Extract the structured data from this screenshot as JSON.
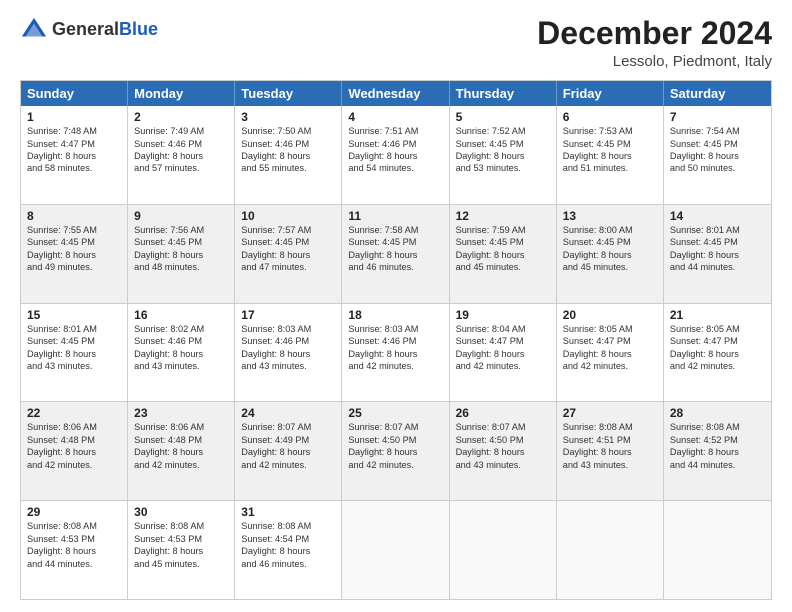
{
  "header": {
    "logo_general": "General",
    "logo_blue": "Blue",
    "month_title": "December 2024",
    "location": "Lessolo, Piedmont, Italy"
  },
  "days_of_week": [
    "Sunday",
    "Monday",
    "Tuesday",
    "Wednesday",
    "Thursday",
    "Friday",
    "Saturday"
  ],
  "rows": [
    [
      {
        "day": "",
        "text": "",
        "empty": true
      },
      {
        "day": "2",
        "text": "Sunrise: 7:49 AM\nSunset: 4:46 PM\nDaylight: 8 hours\nand 57 minutes."
      },
      {
        "day": "3",
        "text": "Sunrise: 7:50 AM\nSunset: 4:46 PM\nDaylight: 8 hours\nand 55 minutes."
      },
      {
        "day": "4",
        "text": "Sunrise: 7:51 AM\nSunset: 4:46 PM\nDaylight: 8 hours\nand 54 minutes."
      },
      {
        "day": "5",
        "text": "Sunrise: 7:52 AM\nSunset: 4:45 PM\nDaylight: 8 hours\nand 53 minutes."
      },
      {
        "day": "6",
        "text": "Sunrise: 7:53 AM\nSunset: 4:45 PM\nDaylight: 8 hours\nand 51 minutes."
      },
      {
        "day": "7",
        "text": "Sunrise: 7:54 AM\nSunset: 4:45 PM\nDaylight: 8 hours\nand 50 minutes."
      }
    ],
    [
      {
        "day": "8",
        "text": "Sunrise: 7:55 AM\nSunset: 4:45 PM\nDaylight: 8 hours\nand 49 minutes."
      },
      {
        "day": "9",
        "text": "Sunrise: 7:56 AM\nSunset: 4:45 PM\nDaylight: 8 hours\nand 48 minutes."
      },
      {
        "day": "10",
        "text": "Sunrise: 7:57 AM\nSunset: 4:45 PM\nDaylight: 8 hours\nand 47 minutes."
      },
      {
        "day": "11",
        "text": "Sunrise: 7:58 AM\nSunset: 4:45 PM\nDaylight: 8 hours\nand 46 minutes."
      },
      {
        "day": "12",
        "text": "Sunrise: 7:59 AM\nSunset: 4:45 PM\nDaylight: 8 hours\nand 45 minutes."
      },
      {
        "day": "13",
        "text": "Sunrise: 8:00 AM\nSunset: 4:45 PM\nDaylight: 8 hours\nand 45 minutes."
      },
      {
        "day": "14",
        "text": "Sunrise: 8:01 AM\nSunset: 4:45 PM\nDaylight: 8 hours\nand 44 minutes."
      }
    ],
    [
      {
        "day": "15",
        "text": "Sunrise: 8:01 AM\nSunset: 4:45 PM\nDaylight: 8 hours\nand 43 minutes."
      },
      {
        "day": "16",
        "text": "Sunrise: 8:02 AM\nSunset: 4:46 PM\nDaylight: 8 hours\nand 43 minutes."
      },
      {
        "day": "17",
        "text": "Sunrise: 8:03 AM\nSunset: 4:46 PM\nDaylight: 8 hours\nand 43 minutes."
      },
      {
        "day": "18",
        "text": "Sunrise: 8:03 AM\nSunset: 4:46 PM\nDaylight: 8 hours\nand 42 minutes."
      },
      {
        "day": "19",
        "text": "Sunrise: 8:04 AM\nSunset: 4:47 PM\nDaylight: 8 hours\nand 42 minutes."
      },
      {
        "day": "20",
        "text": "Sunrise: 8:05 AM\nSunset: 4:47 PM\nDaylight: 8 hours\nand 42 minutes."
      },
      {
        "day": "21",
        "text": "Sunrise: 8:05 AM\nSunset: 4:47 PM\nDaylight: 8 hours\nand 42 minutes."
      }
    ],
    [
      {
        "day": "22",
        "text": "Sunrise: 8:06 AM\nSunset: 4:48 PM\nDaylight: 8 hours\nand 42 minutes."
      },
      {
        "day": "23",
        "text": "Sunrise: 8:06 AM\nSunset: 4:48 PM\nDaylight: 8 hours\nand 42 minutes."
      },
      {
        "day": "24",
        "text": "Sunrise: 8:07 AM\nSunset: 4:49 PM\nDaylight: 8 hours\nand 42 minutes."
      },
      {
        "day": "25",
        "text": "Sunrise: 8:07 AM\nSunset: 4:50 PM\nDaylight: 8 hours\nand 42 minutes."
      },
      {
        "day": "26",
        "text": "Sunrise: 8:07 AM\nSunset: 4:50 PM\nDaylight: 8 hours\nand 43 minutes."
      },
      {
        "day": "27",
        "text": "Sunrise: 8:08 AM\nSunset: 4:51 PM\nDaylight: 8 hours\nand 43 minutes."
      },
      {
        "day": "28",
        "text": "Sunrise: 8:08 AM\nSunset: 4:52 PM\nDaylight: 8 hours\nand 44 minutes."
      }
    ],
    [
      {
        "day": "29",
        "text": "Sunrise: 8:08 AM\nSunset: 4:53 PM\nDaylight: 8 hours\nand 44 minutes."
      },
      {
        "day": "30",
        "text": "Sunrise: 8:08 AM\nSunset: 4:53 PM\nDaylight: 8 hours\nand 45 minutes."
      },
      {
        "day": "31",
        "text": "Sunrise: 8:08 AM\nSunset: 4:54 PM\nDaylight: 8 hours\nand 46 minutes."
      },
      {
        "day": "",
        "text": "",
        "empty": true
      },
      {
        "day": "",
        "text": "",
        "empty": true
      },
      {
        "day": "",
        "text": "",
        "empty": true
      },
      {
        "day": "",
        "text": "",
        "empty": true
      }
    ]
  ],
  "row1_first": {
    "day": "1",
    "text": "Sunrise: 7:48 AM\nSunset: 4:47 PM\nDaylight: 8 hours\nand 58 minutes."
  }
}
